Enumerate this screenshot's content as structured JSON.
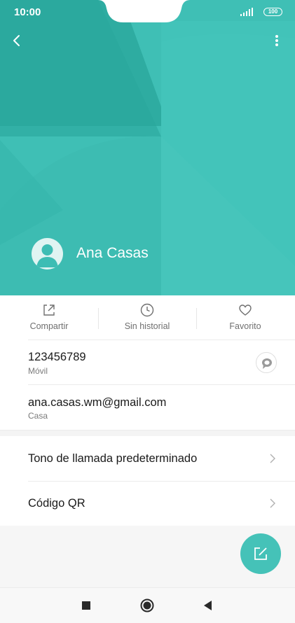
{
  "status_bar": {
    "time": "10:00",
    "battery": "100"
  },
  "contact": {
    "name": "Ana Casas"
  },
  "actions": [
    {
      "label": "Compartir"
    },
    {
      "label": "Sin historial"
    },
    {
      "label": "Favorito"
    }
  ],
  "phone": {
    "number": "123456789",
    "type": "Móvil"
  },
  "email": {
    "address": "ana.casas.wm@gmail.com",
    "type": "Casa"
  },
  "settings": [
    {
      "label": "Tono de llamada predeterminado"
    },
    {
      "label": "Código QR"
    }
  ],
  "colors": {
    "accent": "#3dbdb4",
    "fab": "#45c2b8"
  },
  "icons": {
    "back": "back-arrow-icon",
    "menu": "more-vertical-icon",
    "share": "share-icon",
    "history": "clock-icon",
    "favorite": "heart-icon",
    "message": "message-bubble-icon",
    "edit": "edit-icon"
  }
}
